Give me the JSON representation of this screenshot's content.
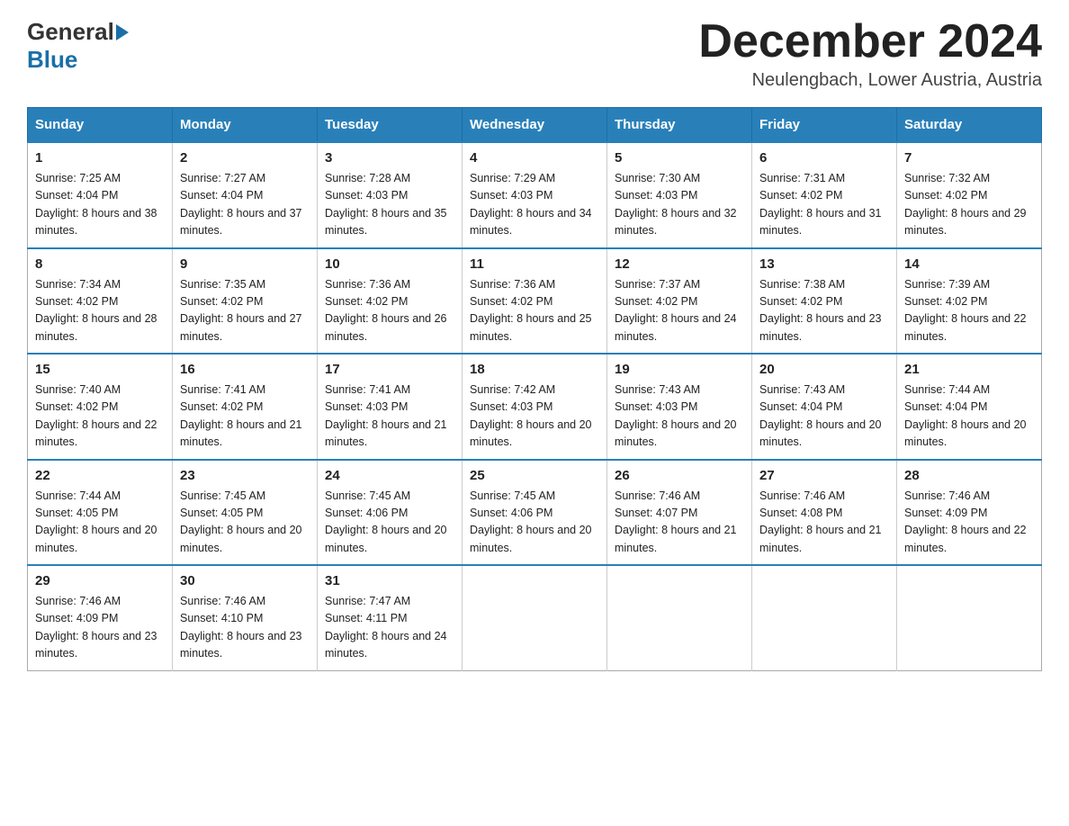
{
  "header": {
    "logo_general": "General",
    "logo_blue": "Blue",
    "month_title": "December 2024",
    "location": "Neulengbach, Lower Austria, Austria"
  },
  "weekdays": [
    "Sunday",
    "Monday",
    "Tuesday",
    "Wednesday",
    "Thursday",
    "Friday",
    "Saturday"
  ],
  "weeks": [
    [
      {
        "day": "1",
        "sunrise": "7:25 AM",
        "sunset": "4:04 PM",
        "daylight": "8 hours and 38 minutes."
      },
      {
        "day": "2",
        "sunrise": "7:27 AM",
        "sunset": "4:04 PM",
        "daylight": "8 hours and 37 minutes."
      },
      {
        "day": "3",
        "sunrise": "7:28 AM",
        "sunset": "4:03 PM",
        "daylight": "8 hours and 35 minutes."
      },
      {
        "day": "4",
        "sunrise": "7:29 AM",
        "sunset": "4:03 PM",
        "daylight": "8 hours and 34 minutes."
      },
      {
        "day": "5",
        "sunrise": "7:30 AM",
        "sunset": "4:03 PM",
        "daylight": "8 hours and 32 minutes."
      },
      {
        "day": "6",
        "sunrise": "7:31 AM",
        "sunset": "4:02 PM",
        "daylight": "8 hours and 31 minutes."
      },
      {
        "day": "7",
        "sunrise": "7:32 AM",
        "sunset": "4:02 PM",
        "daylight": "8 hours and 29 minutes."
      }
    ],
    [
      {
        "day": "8",
        "sunrise": "7:34 AM",
        "sunset": "4:02 PM",
        "daylight": "8 hours and 28 minutes."
      },
      {
        "day": "9",
        "sunrise": "7:35 AM",
        "sunset": "4:02 PM",
        "daylight": "8 hours and 27 minutes."
      },
      {
        "day": "10",
        "sunrise": "7:36 AM",
        "sunset": "4:02 PM",
        "daylight": "8 hours and 26 minutes."
      },
      {
        "day": "11",
        "sunrise": "7:36 AM",
        "sunset": "4:02 PM",
        "daylight": "8 hours and 25 minutes."
      },
      {
        "day": "12",
        "sunrise": "7:37 AM",
        "sunset": "4:02 PM",
        "daylight": "8 hours and 24 minutes."
      },
      {
        "day": "13",
        "sunrise": "7:38 AM",
        "sunset": "4:02 PM",
        "daylight": "8 hours and 23 minutes."
      },
      {
        "day": "14",
        "sunrise": "7:39 AM",
        "sunset": "4:02 PM",
        "daylight": "8 hours and 22 minutes."
      }
    ],
    [
      {
        "day": "15",
        "sunrise": "7:40 AM",
        "sunset": "4:02 PM",
        "daylight": "8 hours and 22 minutes."
      },
      {
        "day": "16",
        "sunrise": "7:41 AM",
        "sunset": "4:02 PM",
        "daylight": "8 hours and 21 minutes."
      },
      {
        "day": "17",
        "sunrise": "7:41 AM",
        "sunset": "4:03 PM",
        "daylight": "8 hours and 21 minutes."
      },
      {
        "day": "18",
        "sunrise": "7:42 AM",
        "sunset": "4:03 PM",
        "daylight": "8 hours and 20 minutes."
      },
      {
        "day": "19",
        "sunrise": "7:43 AM",
        "sunset": "4:03 PM",
        "daylight": "8 hours and 20 minutes."
      },
      {
        "day": "20",
        "sunrise": "7:43 AM",
        "sunset": "4:04 PM",
        "daylight": "8 hours and 20 minutes."
      },
      {
        "day": "21",
        "sunrise": "7:44 AM",
        "sunset": "4:04 PM",
        "daylight": "8 hours and 20 minutes."
      }
    ],
    [
      {
        "day": "22",
        "sunrise": "7:44 AM",
        "sunset": "4:05 PM",
        "daylight": "8 hours and 20 minutes."
      },
      {
        "day": "23",
        "sunrise": "7:45 AM",
        "sunset": "4:05 PM",
        "daylight": "8 hours and 20 minutes."
      },
      {
        "day": "24",
        "sunrise": "7:45 AM",
        "sunset": "4:06 PM",
        "daylight": "8 hours and 20 minutes."
      },
      {
        "day": "25",
        "sunrise": "7:45 AM",
        "sunset": "4:06 PM",
        "daylight": "8 hours and 20 minutes."
      },
      {
        "day": "26",
        "sunrise": "7:46 AM",
        "sunset": "4:07 PM",
        "daylight": "8 hours and 21 minutes."
      },
      {
        "day": "27",
        "sunrise": "7:46 AM",
        "sunset": "4:08 PM",
        "daylight": "8 hours and 21 minutes."
      },
      {
        "day": "28",
        "sunrise": "7:46 AM",
        "sunset": "4:09 PM",
        "daylight": "8 hours and 22 minutes."
      }
    ],
    [
      {
        "day": "29",
        "sunrise": "7:46 AM",
        "sunset": "4:09 PM",
        "daylight": "8 hours and 23 minutes."
      },
      {
        "day": "30",
        "sunrise": "7:46 AM",
        "sunset": "4:10 PM",
        "daylight": "8 hours and 23 minutes."
      },
      {
        "day": "31",
        "sunrise": "7:47 AM",
        "sunset": "4:11 PM",
        "daylight": "8 hours and 24 minutes."
      },
      null,
      null,
      null,
      null
    ]
  ]
}
